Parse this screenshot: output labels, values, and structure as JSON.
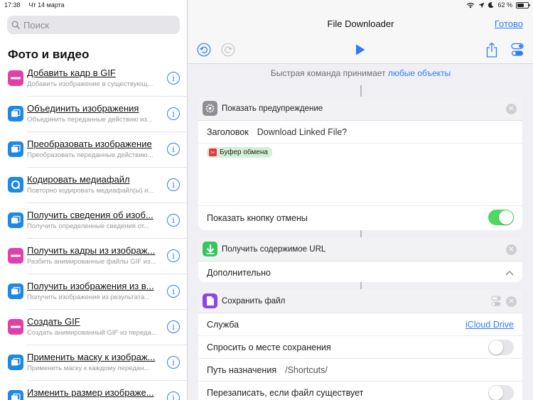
{
  "status": {
    "time": "17:38",
    "date": "Чт 14 марта",
    "battery": "62 %",
    "battery_level": 0.62
  },
  "search": {
    "placeholder": "Поиск"
  },
  "sidebar": {
    "section_title": "Фото и видео",
    "items": [
      {
        "title": "Добавить кадр в GIF",
        "desc": "Добавить изображение в существующ...",
        "icon": "gif-icon",
        "color": "#e040a8"
      },
      {
        "title": "Объединить изображения",
        "desc": "Объединить переданные действию из...",
        "icon": "photos-icon",
        "color": "#1e88e5"
      },
      {
        "title": "Преобразовать изображение",
        "desc": "Преобразовать переданные действию...",
        "icon": "photos-icon",
        "color": "#1e88e5"
      },
      {
        "title": "Кодировать медиафайл",
        "desc": "Повторно кодировать медиафайл(ы) и...",
        "icon": "quicktime-icon",
        "color": "#1e88e5"
      },
      {
        "title": "Получить сведения об изоб...",
        "desc": "Получить определенные сведения от...",
        "icon": "photos-icon",
        "color": "#1e88e5"
      },
      {
        "title": "Получить кадры из изображ...",
        "desc": "Разбить анимированные файлы GIF из...",
        "icon": "gif-icon",
        "color": "#e040a8"
      },
      {
        "title": "Получить изображения из в...",
        "desc": "Получить изображения из результата...",
        "icon": "photos-icon",
        "color": "#1e88e5"
      },
      {
        "title": "Создать GIF",
        "desc": "Создать анимированный GIF из переда...",
        "icon": "gif-icon",
        "color": "#e040a8"
      },
      {
        "title": "Применить маску к изображ...",
        "desc": "Применить маску к каждому передан...",
        "icon": "photos-icon",
        "color": "#1e88e5"
      },
      {
        "title": "Изменить размер изображе...",
        "desc": "Изменить размер переданных изобр...",
        "icon": "photos-icon",
        "color": "#1e88e5"
      }
    ]
  },
  "nav": {
    "title": "File Downloader",
    "done_label": "Готово"
  },
  "banner": {
    "text": "Быстрая команда принимает ",
    "link": "любые объекты"
  },
  "cards": {
    "alert": {
      "title": "Показать предупреждение",
      "header_label": "Заголовок",
      "header_value": "Download Linked File?",
      "chip_label": "Буфер обмена",
      "cancel_label": "Показать кнопку отмены",
      "cancel_on": true
    },
    "url": {
      "title": "Получить содержимое URL",
      "more_label": "Дополнительно"
    },
    "save": {
      "title": "Сохранить файл",
      "service_label": "Служба",
      "service_value": "iCloud Drive",
      "ask_label": "Спросить о месте сохранения",
      "ask_on": false,
      "path_label": "Путь назначения",
      "path_value": "/Shortcuts/",
      "overwrite_label": "Перезаписать, если файл существует",
      "overwrite_on": false
    }
  },
  "colors": {
    "accent": "#2f7cf6",
    "toggle_on": "#4cd964",
    "chip_bg": "#d4f1d6",
    "url_icon": "#34c759",
    "save_icon": "#8e44e6",
    "alert_icon": "#8e8e93"
  }
}
